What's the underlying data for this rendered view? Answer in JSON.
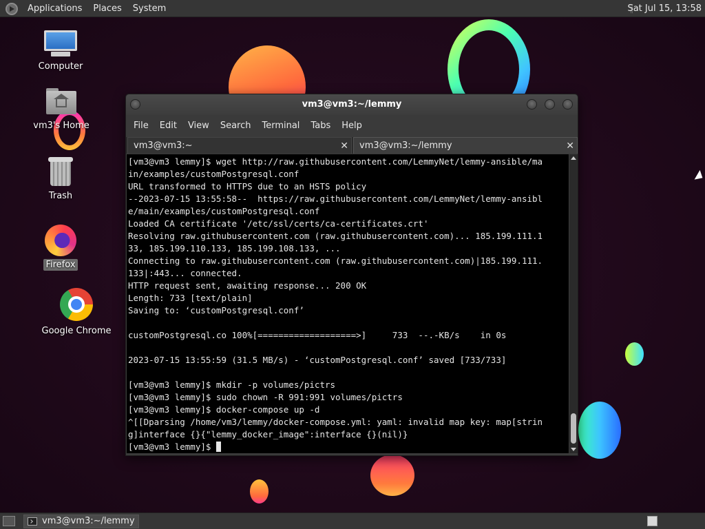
{
  "top_panel": {
    "menu": [
      "Applications",
      "Places",
      "System"
    ],
    "clock": "Sat Jul 15, 13:58"
  },
  "desktop": {
    "icons": [
      {
        "label": "Computer",
        "icon": "computer-icon"
      },
      {
        "label": "vm3's Home",
        "icon": "home-folder-icon"
      },
      {
        "label": "Trash",
        "icon": "trash-icon"
      },
      {
        "label": "Firefox",
        "icon": "firefox-icon"
      },
      {
        "label": "Google Chrome",
        "icon": "chrome-icon"
      }
    ]
  },
  "window": {
    "title": "vm3@vm3:~/lemmy",
    "menu": [
      "File",
      "Edit",
      "View",
      "Search",
      "Terminal",
      "Tabs",
      "Help"
    ],
    "tabs": [
      {
        "label": "vm3@vm3:~",
        "active": false
      },
      {
        "label": "vm3@vm3:~/lemmy",
        "active": true
      }
    ],
    "terminal_lines": [
      "[vm3@vm3 lemmy]$ wget http://raw.githubusercontent.com/LemmyNet/lemmy-ansible/ma",
      "in/examples/customPostgresql.conf",
      "URL transformed to HTTPS due to an HSTS policy",
      "--2023-07-15 13:55:58--  https://raw.githubusercontent.com/LemmyNet/lemmy-ansibl",
      "e/main/examples/customPostgresql.conf",
      "Loaded CA certificate '/etc/ssl/certs/ca-certificates.crt'",
      "Resolving raw.githubusercontent.com (raw.githubusercontent.com)... 185.199.111.1",
      "33, 185.199.110.133, 185.199.108.133, ...",
      "Connecting to raw.githubusercontent.com (raw.githubusercontent.com)|185.199.111.",
      "133|:443... connected.",
      "HTTP request sent, awaiting response... 200 OK",
      "Length: 733 [text/plain]",
      "Saving to: ‘customPostgresql.conf’",
      "",
      "customPostgresql.co 100%[===================>]     733  --.-KB/s    in 0s",
      "",
      "2023-07-15 13:55:59 (31.5 MB/s) - ‘customPostgresql.conf’ saved [733/733]",
      "",
      "[vm3@vm3 lemmy]$ mkdir -p volumes/pictrs",
      "[vm3@vm3 lemmy]$ sudo chown -R 991:991 volumes/pictrs",
      "[vm3@vm3 lemmy]$ docker-compose up -d",
      "^[[Dparsing /home/vm3/lemmy/docker-compose.yml: yaml: invalid map key: map[strin",
      "g]interface {}{\"lemmy_docker_image\":interface {}(nil)}"
    ],
    "prompt": "[vm3@vm3 lemmy]$ "
  },
  "bottom_panel": {
    "task_label": "vm3@vm3:~/lemmy"
  },
  "colors": {
    "panel_bg": "#363636",
    "terminal_bg": "#000000",
    "terminal_fg": "#e6e6e6",
    "desktop_bg": "#1d0818"
  }
}
